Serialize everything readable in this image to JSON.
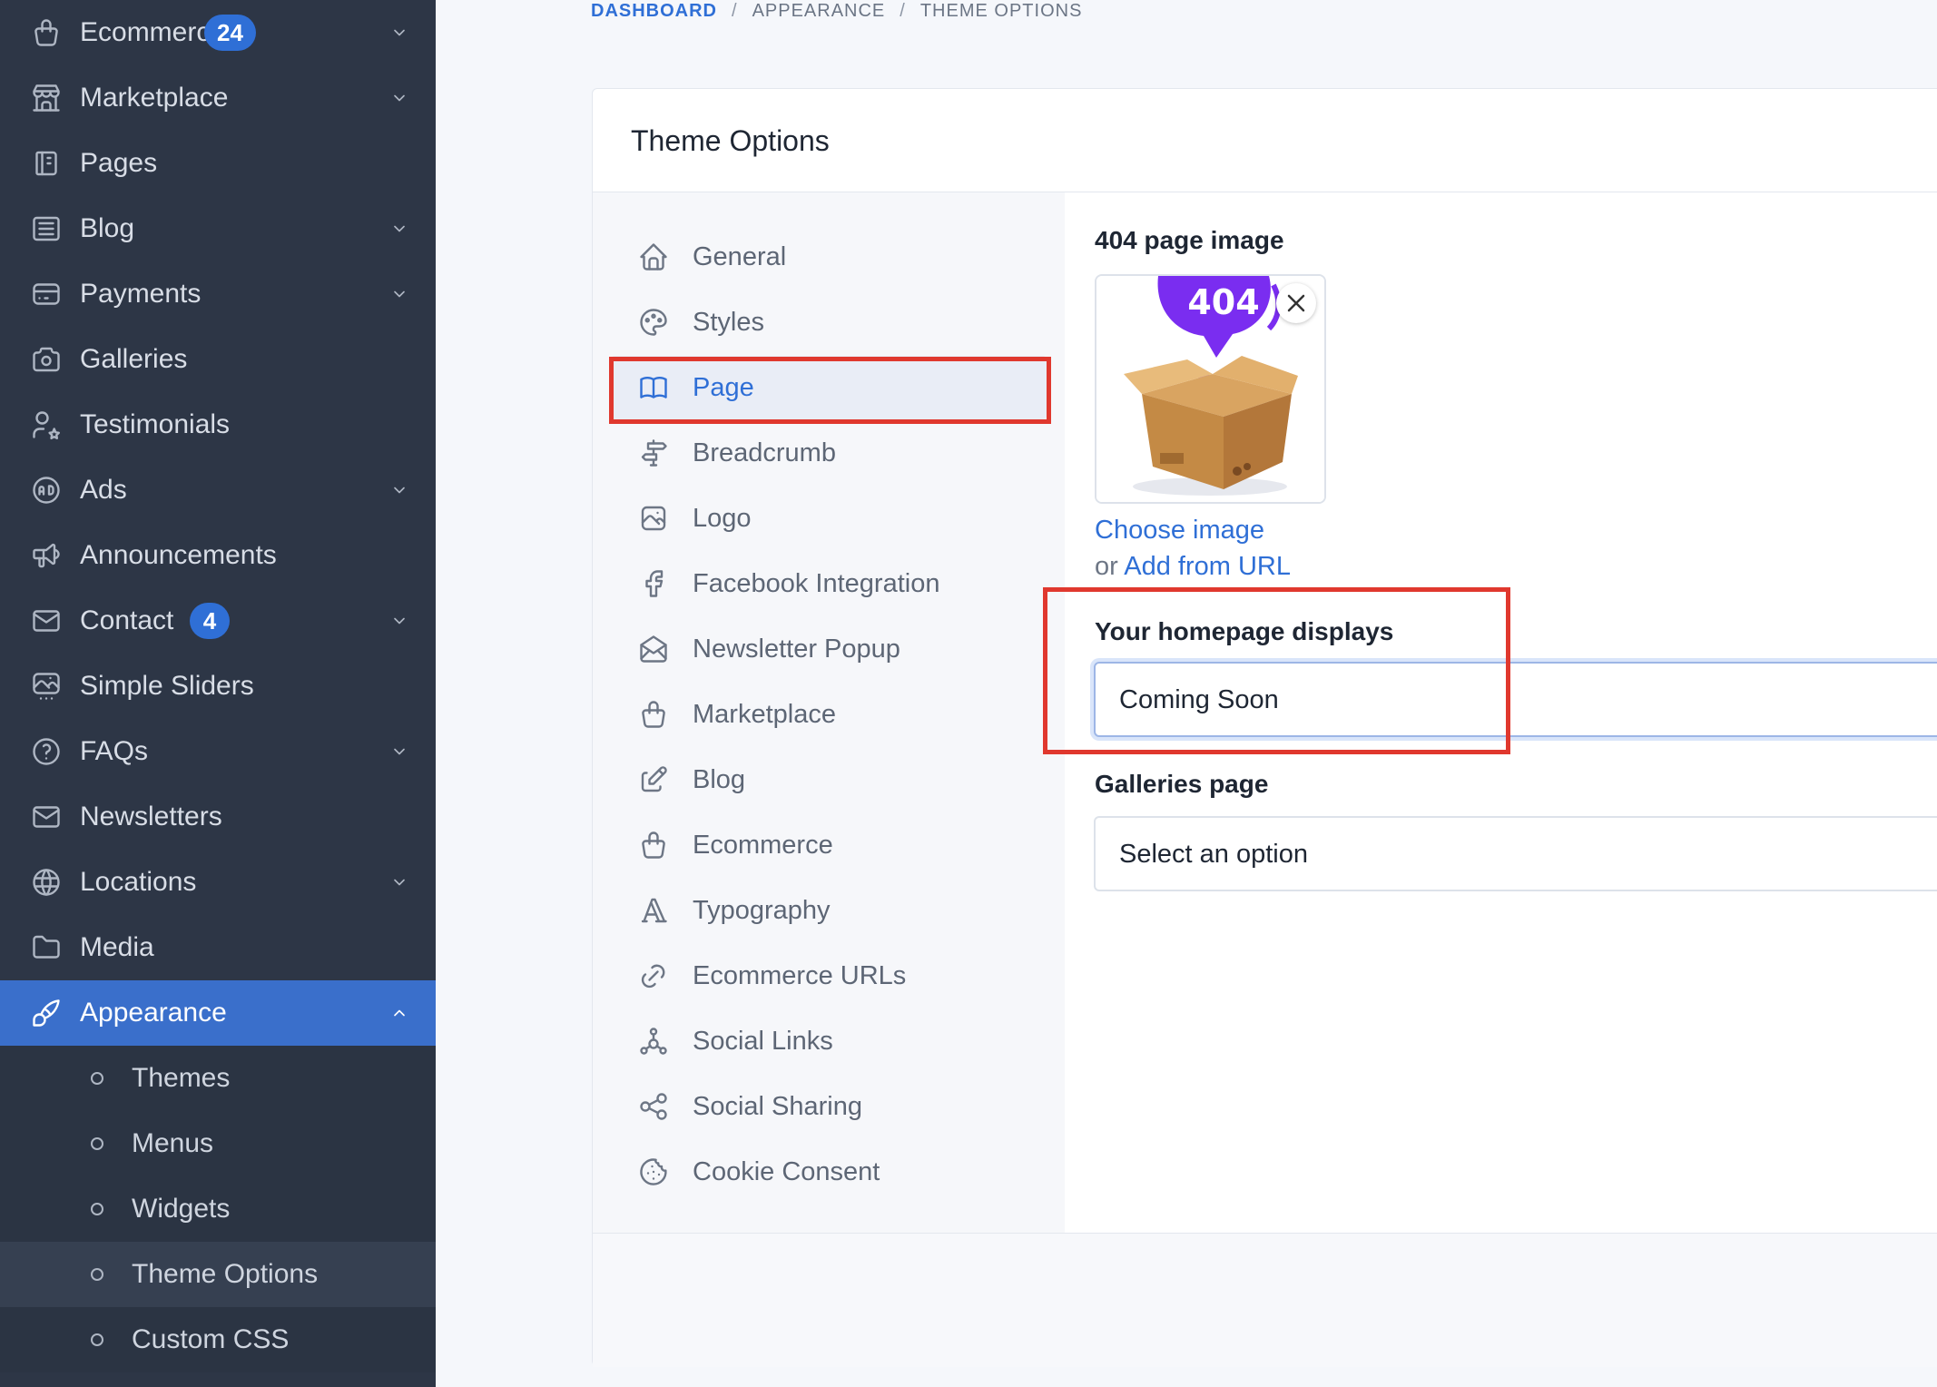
{
  "sidebar": {
    "items": [
      {
        "label": "Ecommerce",
        "icon": "shopping-bag-icon",
        "badge": "24",
        "chevron": true
      },
      {
        "label": "Marketplace",
        "icon": "building-store-icon",
        "chevron": true
      },
      {
        "label": "Pages",
        "icon": "notebook-icon"
      },
      {
        "label": "Blog",
        "icon": "article-icon",
        "chevron": true
      },
      {
        "label": "Payments",
        "icon": "credit-card-icon",
        "chevron": true
      },
      {
        "label": "Galleries",
        "icon": "camera-icon"
      },
      {
        "label": "Testimonials",
        "icon": "user-star-icon"
      },
      {
        "label": "Ads",
        "icon": "ad-circle-icon",
        "chevron": true
      },
      {
        "label": "Announcements",
        "icon": "speakerphone-icon"
      },
      {
        "label": "Contact",
        "icon": "mail-icon",
        "badge": "4",
        "chevron": true
      },
      {
        "label": "Simple Sliders",
        "icon": "slideshow-icon"
      },
      {
        "label": "FAQs",
        "icon": "help-circle-icon",
        "chevron": true
      },
      {
        "label": "Newsletters",
        "icon": "mail-icon"
      },
      {
        "label": "Locations",
        "icon": "world-icon",
        "chevron": true
      },
      {
        "label": "Media",
        "icon": "folder-icon"
      },
      {
        "label": "Appearance",
        "icon": "brush-icon",
        "chevron": true,
        "active": true
      }
    ],
    "appearance_sub": [
      {
        "label": "Themes"
      },
      {
        "label": "Menus"
      },
      {
        "label": "Widgets"
      },
      {
        "label": "Theme Options",
        "current": true
      },
      {
        "label": "Custom CSS"
      }
    ]
  },
  "breadcrumb": {
    "items": [
      "DASHBOARD",
      "APPEARANCE",
      "THEME OPTIONS"
    ],
    "separator": "/"
  },
  "card": {
    "title": "Theme Options"
  },
  "tabs": [
    {
      "label": "General",
      "icon": "home-icon"
    },
    {
      "label": "Styles",
      "icon": "palette-icon"
    },
    {
      "label": "Page",
      "icon": "book-icon",
      "active": true
    },
    {
      "label": "Breadcrumb",
      "icon": "directions-icon"
    },
    {
      "label": "Logo",
      "icon": "photo-icon"
    },
    {
      "label": "Facebook Integration",
      "icon": "facebook-icon"
    },
    {
      "label": "Newsletter Popup",
      "icon": "mail-opened-icon"
    },
    {
      "label": "Marketplace",
      "icon": "shopping-bag-icon"
    },
    {
      "label": "Blog",
      "icon": "edit-icon"
    },
    {
      "label": "Ecommerce",
      "icon": "shopping-bag-icon"
    },
    {
      "label": "Typography",
      "icon": "typography-icon"
    },
    {
      "label": "Ecommerce URLs",
      "icon": "link-icon"
    },
    {
      "label": "Social Links",
      "icon": "affiliate-icon"
    },
    {
      "label": "Social Sharing",
      "icon": "share-icon"
    },
    {
      "label": "Cookie Consent",
      "icon": "cookie-icon"
    }
  ],
  "content": {
    "image_field": {
      "label": "404 page image",
      "image_text": "404",
      "choose_label": "Choose image",
      "or_text": "or",
      "add_url_label": "Add from URL"
    },
    "homepage_field": {
      "label": "Your homepage displays",
      "value": "Coming Soon"
    },
    "galleries_field": {
      "label": "Galleries page",
      "value": "Select an option"
    }
  },
  "colors": {
    "sidebar_bg": "#2d3646",
    "accent": "#2f6fd6",
    "active_nav": "#3a6fcb",
    "highlight_red": "#e0382e"
  }
}
